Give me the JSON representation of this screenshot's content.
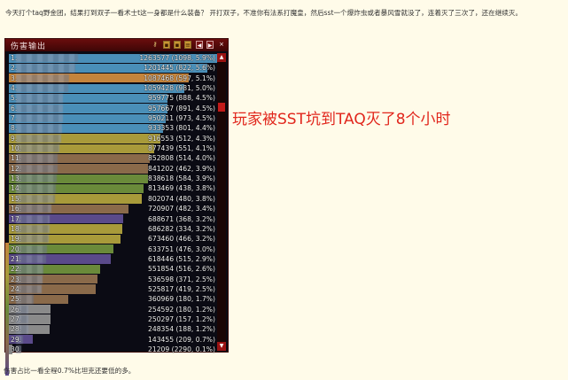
{
  "post": {
    "top_text": "今天打个taq野金团，结果打到双子一看术士t这一身都是什么装备？ 开打双子，不准你有法系打魔皇，然后sst一个爆炸虫或者暴风雪就没了，连着灭了三次了，还在继续灭。",
    "overlay": "玩家被SST坑到TAQ灭了8个小时",
    "bottom_text": "伤害占比一看全程0.7%比坦克还要低的多。"
  },
  "meter": {
    "title": "伤害输出",
    "icons": [
      "key-icon",
      "report-icon",
      "copy-icon",
      "list-icon",
      "left-arrow-icon",
      "right-arrow-icon",
      "close-icon"
    ],
    "rows": [
      {
        "rank": "1.",
        "value": "1263577 (1098, 5.9%)",
        "fill": 1.0,
        "color": "#4a8fb8"
      },
      {
        "rank": "2.",
        "value": "1201445 (822, 5.6%)",
        "fill": 0.951,
        "color": "#4a8fb8"
      },
      {
        "rank": "3.",
        "value": "1087468 (597, 5.1%)",
        "fill": 0.861,
        "color": "#c4843c"
      },
      {
        "rank": "4.",
        "value": "1059428 (981, 5.0%)",
        "fill": 0.838,
        "color": "#4a8fb8"
      },
      {
        "rank": "5.",
        "value": "959775 (888, 4.5%)",
        "fill": 0.76,
        "color": "#4a8fb8"
      },
      {
        "rank": "6.",
        "value": "957667 (891, 4.5%)",
        "fill": 0.758,
        "color": "#4a8fb8"
      },
      {
        "rank": "7.",
        "value": "950211 (973, 4.5%)",
        "fill": 0.752,
        "color": "#4a8fb8"
      },
      {
        "rank": "8.",
        "value": "933353 (801, 4.4%)",
        "fill": 0.739,
        "color": "#4a8fb8"
      },
      {
        "rank": "9.",
        "value": "916553 (512, 4.3%)",
        "fill": 0.725,
        "color": "#a89a3a"
      },
      {
        "rank": "10.",
        "value": "877439 (551, 4.1%)",
        "fill": 0.694,
        "color": "#a89a3a"
      },
      {
        "rank": "11.",
        "value": "852808 (514, 4.0%)",
        "fill": 0.675,
        "color": "#8a6a4a"
      },
      {
        "rank": "12.",
        "value": "841202 (462, 3.9%)",
        "fill": 0.666,
        "color": "#8a6a4a"
      },
      {
        "rank": "13.",
        "value": "838618 (584, 3.9%)",
        "fill": 0.664,
        "color": "#6a8a3a"
      },
      {
        "rank": "14.",
        "value": "813469 (438, 3.8%)",
        "fill": 0.644,
        "color": "#6a8a3a"
      },
      {
        "rank": "15.",
        "value": "802074 (480, 3.8%)",
        "fill": 0.635,
        "color": "#a89a3a"
      },
      {
        "rank": "16.",
        "value": "720907 (482, 3.4%)",
        "fill": 0.571,
        "color": "#8a6a4a"
      },
      {
        "rank": "17.",
        "value": "688671 (368, 3.2%)",
        "fill": 0.545,
        "color": "#5a4a8a"
      },
      {
        "rank": "18.",
        "value": "686282 (334, 3.2%)",
        "fill": 0.543,
        "color": "#a89a3a"
      },
      {
        "rank": "19.",
        "value": "673460 (466, 3.2%)",
        "fill": 0.533,
        "color": "#a89a3a"
      },
      {
        "rank": "20.",
        "value": "633751 (476, 3.0%)",
        "fill": 0.502,
        "color": "#6a8a3a"
      },
      {
        "rank": "21.",
        "value": "618446 (515, 2.9%)",
        "fill": 0.489,
        "color": "#5a4a8a"
      },
      {
        "rank": "22.",
        "value": "551854 (516, 2.6%)",
        "fill": 0.437,
        "color": "#6a8a3a"
      },
      {
        "rank": "23.",
        "value": "536598 (371, 2.5%)",
        "fill": 0.425,
        "color": "#8a6a4a"
      },
      {
        "rank": "24.",
        "value": "525817 (419, 2.5%)",
        "fill": 0.416,
        "color": "#8a6a4a"
      },
      {
        "rank": "25.",
        "value": "360969 (180, 1.7%)",
        "fill": 0.286,
        "color": "#8a6a4a"
      },
      {
        "rank": "26.",
        "value": "254592 (180, 1.2%)",
        "fill": 0.201,
        "color": "#8a8a8a"
      },
      {
        "rank": "27.",
        "value": "250297 (157, 1.2%)",
        "fill": 0.198,
        "color": "#8a8a8a"
      },
      {
        "rank": "28.",
        "value": "248354 (188, 1.2%)",
        "fill": 0.197,
        "color": "#8a8a8a"
      },
      {
        "rank": "29.",
        "value": "143455 (209, 0.7%)",
        "fill": 0.114,
        "color": "#5a4a8a"
      },
      {
        "rank": "30.",
        "value": "21209 (2290, 0.1%)",
        "fill": 0.017,
        "color": "#8a8a8a"
      }
    ]
  }
}
